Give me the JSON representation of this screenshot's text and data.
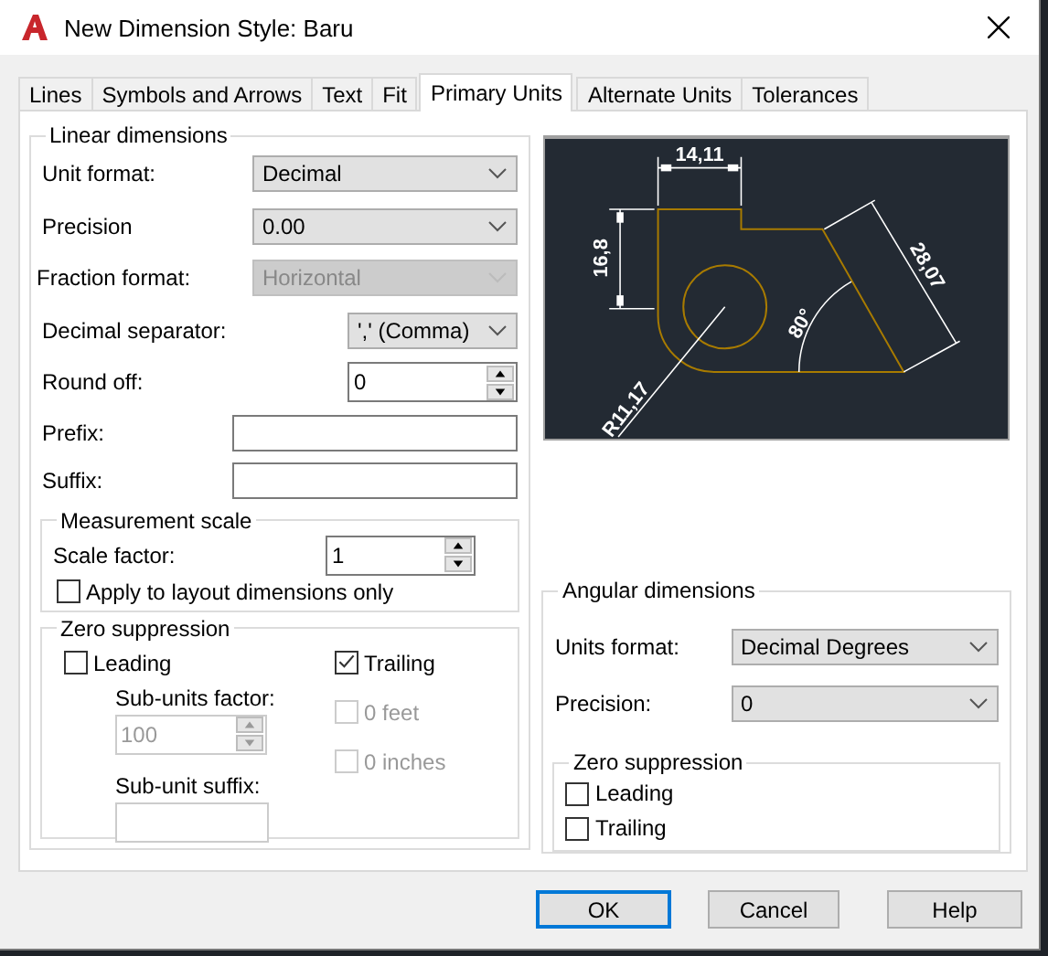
{
  "window": {
    "title": "New Dimension Style: Baru"
  },
  "tabs": [
    {
      "label": "Lines",
      "selected": false
    },
    {
      "label": "Symbols and Arrows",
      "selected": false
    },
    {
      "label": "Text",
      "selected": false
    },
    {
      "label": "Fit",
      "selected": false
    },
    {
      "label": "Primary Units",
      "selected": true
    },
    {
      "label": "Alternate Units",
      "selected": false
    },
    {
      "label": "Tolerances",
      "selected": false
    }
  ],
  "linear": {
    "legend": "Linear dimensions",
    "rows": [
      {
        "kind": "select",
        "label": "Unit format:",
        "value": "Decimal"
      },
      {
        "kind": "select",
        "label": "Precision",
        "value": "0.00"
      },
      {
        "kind": "select",
        "label": "Fraction format:",
        "value": "Horizontal",
        "disabled": true
      },
      {
        "kind": "select",
        "label": "Decimal separator:",
        "value": "',' (Comma)"
      },
      {
        "kind": "spin",
        "label": "Round off:",
        "value": "0"
      },
      {
        "kind": "text",
        "label": "Prefix:"
      },
      {
        "kind": "text",
        "label": "Suffix:"
      }
    ]
  },
  "measurement": {
    "legend": "Measurement scale",
    "scale_label": "Scale factor:",
    "scale_value": "1",
    "apply": {
      "label": "Apply to layout dimensions only",
      "checked": false
    }
  },
  "zero": {
    "legend": "Zero suppression",
    "leading": {
      "label": "Leading",
      "checked": false
    },
    "trailing": {
      "label": "Trailing",
      "checked": true
    },
    "subunits_label": "Sub-units factor:",
    "subunits_value": "100",
    "suffix_label": "Sub-unit suffix:",
    "feet": {
      "label": "0 feet",
      "checked": false,
      "disabled": true
    },
    "inches": {
      "label": "0 inches",
      "checked": false,
      "disabled": true
    }
  },
  "preview": {
    "labels": [
      "14,11",
      "16,8",
      "28,07",
      "80°",
      "R11,17"
    ]
  },
  "angular": {
    "legend": "Angular dimensions",
    "units_label": "Units format:",
    "units_value": "Decimal Degrees",
    "precision_label": "Precision:",
    "precision_value": "0",
    "zero": {
      "legend": "Zero suppression",
      "items": [
        {
          "label": "Leading",
          "checked": false
        },
        {
          "label": "Trailing",
          "checked": false
        }
      ]
    }
  },
  "buttons": [
    {
      "label": "OK",
      "default": true
    },
    {
      "label": "Cancel",
      "default": false
    },
    {
      "label": "Help",
      "default": false
    }
  ]
}
